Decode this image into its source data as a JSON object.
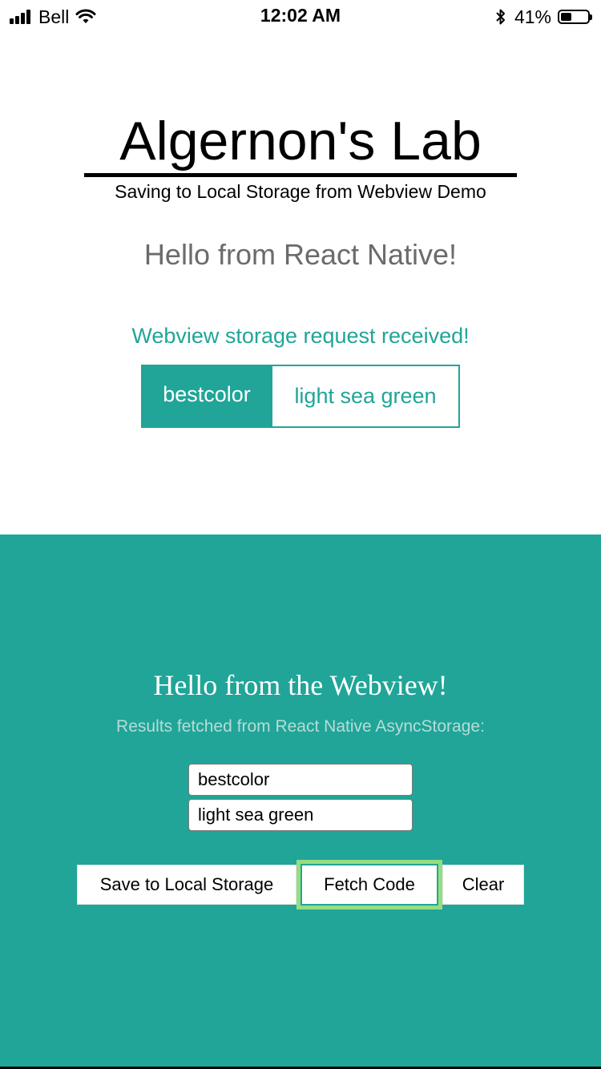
{
  "status_bar": {
    "carrier": "Bell",
    "time": "12:02 AM",
    "battery_percent": "41%",
    "battery_level": 0.41,
    "icons": [
      "signal-icon",
      "wifi-icon",
      "bluetooth-icon",
      "battery-icon"
    ]
  },
  "native": {
    "title": "Algernon's Lab",
    "subtitle": "Saving to Local Storage from Webview Demo",
    "hello": "Hello from React Native!",
    "status": "Webview storage request received!",
    "stored_key": "bestcolor",
    "stored_value": "light sea green"
  },
  "webview": {
    "hello": "Hello from the Webview!",
    "results_label": "Results fetched from React Native AsyncStorage:",
    "key_input_value": "bestcolor",
    "value_input_value": "light sea green",
    "buttons": {
      "save": "Save to Local Storage",
      "fetch": "Fetch Code",
      "clear": "Clear"
    }
  },
  "colors": {
    "accent": "#20a598",
    "focus_ring": "#96dd82",
    "muted_text": "#b7dcd7"
  }
}
